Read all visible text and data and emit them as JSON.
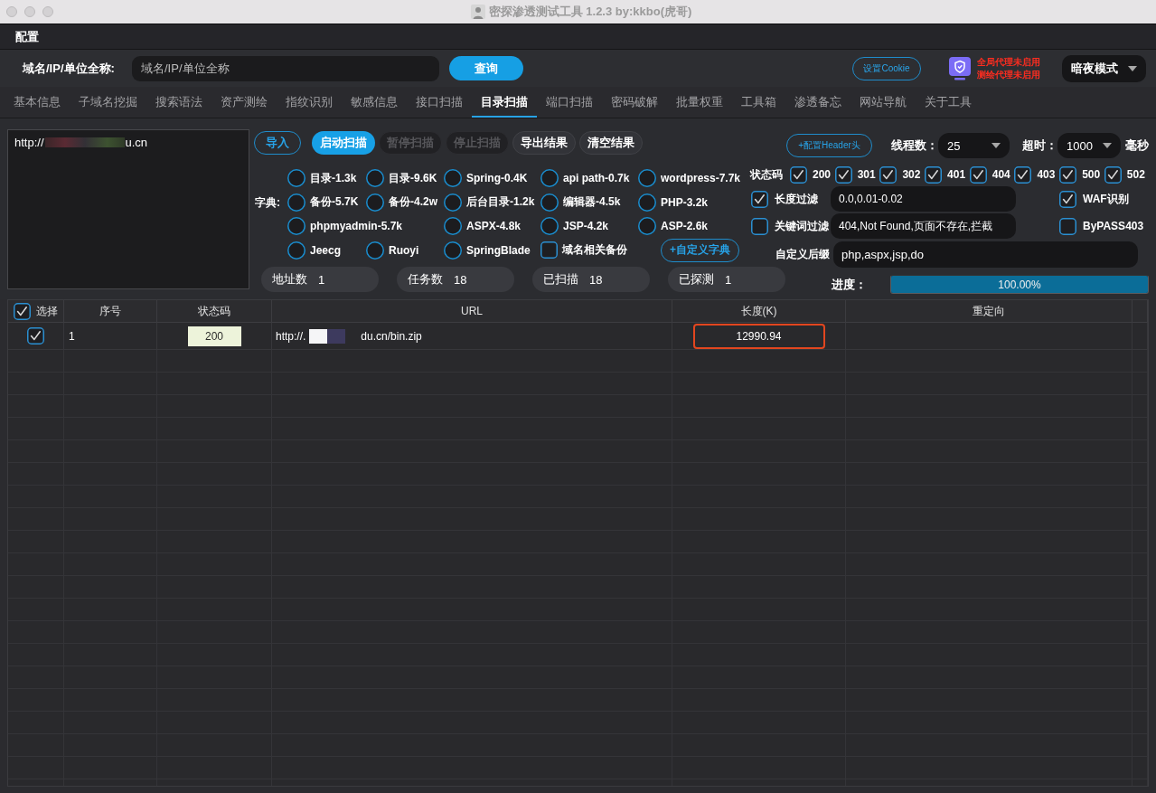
{
  "window": {
    "title": "密探渗透测试工具 1.2.3 by:kkbo(虎哥)"
  },
  "menu_bar": {
    "items": [
      "配置"
    ]
  },
  "query_bar": {
    "label": "域名/IP/单位全称:",
    "search": {
      "placeholder": "域名/IP/单位全称"
    },
    "query_button": "查询",
    "cookie_button": "设置Cookie",
    "proxy_status": [
      "全局代理未启用",
      "测绘代理未启用"
    ],
    "theme_select": {
      "value": "暗夜模式"
    }
  },
  "tabs": [
    {
      "label": "基本信息",
      "selected": false
    },
    {
      "label": "子域名挖掘",
      "selected": false
    },
    {
      "label": "搜索语法",
      "selected": false
    },
    {
      "label": "资产测绘",
      "selected": false
    },
    {
      "label": "指纹识别",
      "selected": false
    },
    {
      "label": "敏感信息",
      "selected": false
    },
    {
      "label": "接口扫描",
      "selected": false
    },
    {
      "label": "目录扫描",
      "selected": true
    },
    {
      "label": "端口扫描",
      "selected": false
    },
    {
      "label": "密码破解",
      "selected": false
    },
    {
      "label": "批量权重",
      "selected": false
    },
    {
      "label": "工具箱",
      "selected": false
    },
    {
      "label": "渗透备忘",
      "selected": false
    },
    {
      "label": "网站导航",
      "selected": false
    },
    {
      "label": "关于工具",
      "selected": false
    }
  ],
  "scan_panel": {
    "targets": [
      {
        "prefix": "http://",
        "suffix": "u.cn",
        "redacted": true
      }
    ],
    "buttons": [
      {
        "label": "导入",
        "kind": "outline",
        "disabled": false
      },
      {
        "label": "启动扫描",
        "kind": "primary",
        "disabled": false
      },
      {
        "label": "暂停扫描",
        "kind": "plain",
        "disabled": true
      },
      {
        "label": "停止扫描",
        "kind": "plain",
        "disabled": true
      },
      {
        "label": "导出结果",
        "kind": "plain",
        "disabled": false
      },
      {
        "label": "清空结果",
        "kind": "plain",
        "disabled": false
      }
    ],
    "header_button": "+配置Header头",
    "threads": {
      "label": "线程数：",
      "value": "25"
    },
    "timeout": {
      "label": "超时：",
      "value": "1000",
      "unit": "毫秒"
    },
    "dictionary": {
      "label": "字典:",
      "rows": [
        [
          {
            "label": "目录-1.3k",
            "kind": "radio",
            "selected": false
          },
          {
            "label": "目录-9.6K",
            "kind": "radio",
            "selected": false
          },
          {
            "label": "Spring-0.4K",
            "kind": "radio",
            "selected": false
          },
          {
            "label": "api path-0.7k",
            "kind": "radio",
            "selected": false
          },
          {
            "label": "wordpress-7.7k",
            "kind": "radio",
            "selected": false
          }
        ],
        [
          {
            "label": "备份-5.7K",
            "kind": "radio",
            "selected": false
          },
          {
            "label": "备份-4.2w",
            "kind": "radio",
            "selected": false
          },
          {
            "label": "后台目录-1.2k",
            "kind": "radio",
            "selected": false
          },
          {
            "label": "编辑器-4.5k",
            "kind": "radio",
            "selected": false
          },
          {
            "label": "PHP-3.2k",
            "kind": "radio",
            "selected": false
          }
        ],
        [
          {
            "label": "phpmyadmin-5.7k",
            "kind": "radio",
            "selected": false
          },
          "",
          {
            "label": "ASPX-4.8k",
            "kind": "radio",
            "selected": false
          },
          {
            "label": "JSP-4.2k",
            "kind": "radio",
            "selected": false
          },
          {
            "label": "ASP-2.6k",
            "kind": "radio",
            "selected": false
          }
        ],
        [
          {
            "label": "Jeecg",
            "kind": "radio",
            "selected": false
          },
          {
            "label": "Ruoyi",
            "kind": "radio",
            "selected": false
          },
          {
            "label": "SpringBlade",
            "kind": "radio",
            "selected": false
          },
          {
            "label": "域名相关备份",
            "kind": "checkbox",
            "checked": false
          },
          {
            "label": "+自定义字典",
            "kind": "button"
          }
        ]
      ]
    },
    "status_codes": {
      "label": "状态码",
      "codes": [
        {
          "code": "200",
          "checked": true
        },
        {
          "code": "301",
          "checked": true
        },
        {
          "code": "302",
          "checked": true
        },
        {
          "code": "401",
          "checked": true
        },
        {
          "code": "404",
          "checked": true
        },
        {
          "code": "403",
          "checked": true
        },
        {
          "code": "500",
          "checked": true
        },
        {
          "code": "502",
          "checked": true
        }
      ]
    },
    "filters": [
      {
        "label": "长度过滤",
        "checked": true,
        "value": "0.0,0.01-0.02"
      },
      {
        "label": "关键词过滤",
        "checked": false,
        "value": "404,Not Found,页面不存在,拦截"
      }
    ],
    "options": [
      {
        "label": "WAF识别",
        "checked": true
      },
      {
        "label": "ByPASS403",
        "checked": false
      }
    ],
    "suffix": {
      "label": "自定义后缀",
      "value": "php,aspx,jsp,do"
    },
    "counters": [
      {
        "label": "地址数",
        "value": "1"
      },
      {
        "label": "任务数",
        "value": "18"
      },
      {
        "label": "已扫描",
        "value": "18"
      },
      {
        "label": "已探测",
        "value": "1"
      }
    ],
    "progress": {
      "label": "进度：",
      "level": 1,
      "reading": "100.00%"
    }
  },
  "table": {
    "select_all": {
      "checked": true
    },
    "columns": [
      "选择",
      "序号",
      "状态码",
      "URL",
      "长度(K)",
      "重定向"
    ],
    "rows": [
      {
        "checked": true,
        "index": "1",
        "status": "200",
        "url": {
          "prefix": "http://.",
          "suffix": "du.cn/bin.zip",
          "redacted": true
        },
        "length": "12990.94",
        "highlighted": true
      }
    ]
  }
}
